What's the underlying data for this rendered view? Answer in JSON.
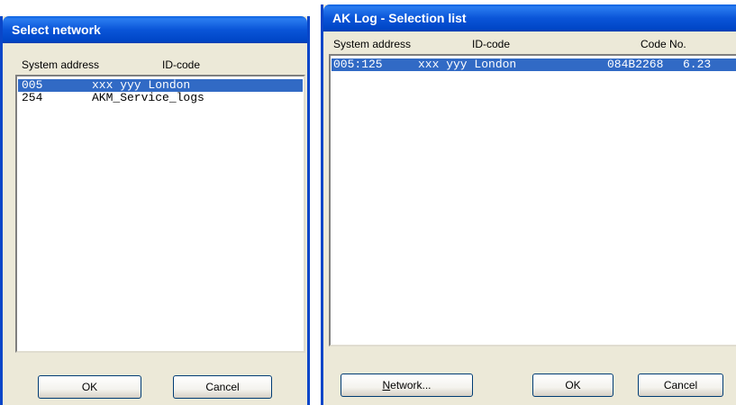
{
  "select_network": {
    "title": "Select network",
    "columns": {
      "system_address": "System address",
      "id_code": "ID-code"
    },
    "rows": [
      {
        "address": "005",
        "id_code": "xxx yyy London",
        "selected": true
      },
      {
        "address": "254",
        "id_code": "AKM_Service_logs",
        "selected": false
      }
    ],
    "buttons": {
      "ok": "OK",
      "cancel": "Cancel"
    }
  },
  "selection_list": {
    "title": "AK Log - Selection list",
    "columns": {
      "system_address": "System address",
      "id_code": "ID-code",
      "code_no": "Code No."
    },
    "rows": [
      {
        "address": "005:125",
        "id_code": "xxx yyy London",
        "code_no": "084B2268",
        "version": "6.23",
        "selected": true
      }
    ],
    "buttons": {
      "network_prefix": "N",
      "network_rest": "etwork...",
      "ok": "OK",
      "cancel": "Cancel"
    }
  }
}
